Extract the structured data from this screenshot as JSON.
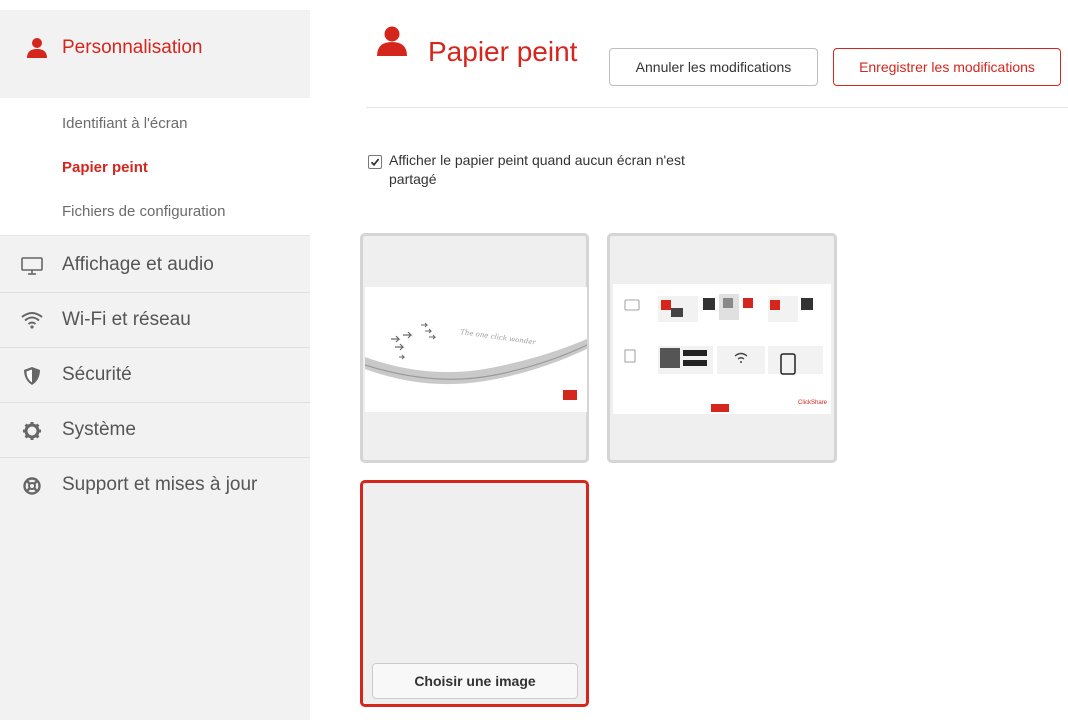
{
  "sidebar": {
    "header": {
      "label": "Personnalisation",
      "icon": "person-icon"
    },
    "subitems": [
      {
        "label": "Identifiant à l'écran",
        "active": false
      },
      {
        "label": "Papier peint",
        "active": true
      },
      {
        "label": "Fichiers de configuration",
        "active": false
      }
    ],
    "items": [
      {
        "label": "Affichage et audio",
        "icon": "monitor-icon"
      },
      {
        "label": "Wi-Fi et réseau",
        "icon": "wifi-icon"
      },
      {
        "label": "Sécurité",
        "icon": "shield-icon"
      },
      {
        "label": "Système",
        "icon": "gear-icon"
      },
      {
        "label": "Support et mises à jour",
        "icon": "lifebuoy-icon"
      }
    ]
  },
  "main": {
    "title": "Papier peint",
    "title_icon": "person-icon",
    "cancel_label": "Annuler les modifications",
    "save_label": "Enregistrer les modifications",
    "checkbox": {
      "checked": true,
      "label": "Afficher le papier peint quand aucun écran n'est partagé"
    },
    "wallpapers": [
      {
        "tagline": "The one click wonder",
        "selected": false
      },
      {
        "brand": "ClickShare",
        "selected": false
      }
    ],
    "choose_label": "Choisir une image"
  },
  "colors": {
    "accent": "#d5261e",
    "sidebar_bg": "#f2f2f2",
    "border": "#d5d5d5"
  }
}
